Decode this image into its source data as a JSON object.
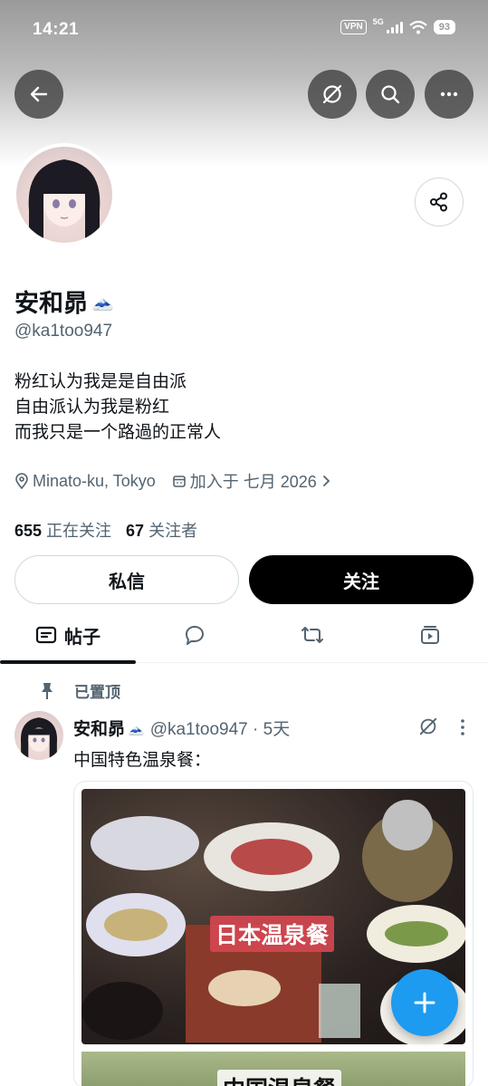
{
  "status_bar": {
    "time": "14:21",
    "vpn": "VPN",
    "network": "5G",
    "battery": "93"
  },
  "profile": {
    "name": "安和昴",
    "name_emoji": "🗻",
    "handle": "@ka1too947",
    "bio": [
      "粉红认为我是是自由派",
      "自由派认为我是粉红",
      "而我只是一个路過的正常人"
    ],
    "location": "Minato-ku, Tokyo",
    "joined": "加入于 七月 2026",
    "following_count": "655",
    "following_label": "正在关注",
    "followers_count": "67",
    "followers_label": "关注者"
  },
  "buttons": {
    "message": "私信",
    "follow": "关注"
  },
  "tabs": {
    "posts": "帖子"
  },
  "post": {
    "pinned_label": "已置顶",
    "author_name": "安和昴",
    "author_emoji": "🗻",
    "meta": "@ka1too947 · 5天",
    "text": "中国特色温泉餐：",
    "image1_caption": "日本温泉餐",
    "image2_caption": "中国温泉餐"
  },
  "colors": {
    "accent": "#1d9bf0",
    "text": "#0f1419",
    "secondary": "#536471"
  },
  "icons": [
    "back-arrow-icon",
    "grok-icon",
    "search-icon",
    "more-icon",
    "share-icon",
    "location-icon",
    "calendar-icon",
    "chevron-right-icon",
    "posts-icon",
    "reply-icon",
    "repost-icon",
    "media-icon",
    "pin-icon",
    "plus-icon"
  ]
}
